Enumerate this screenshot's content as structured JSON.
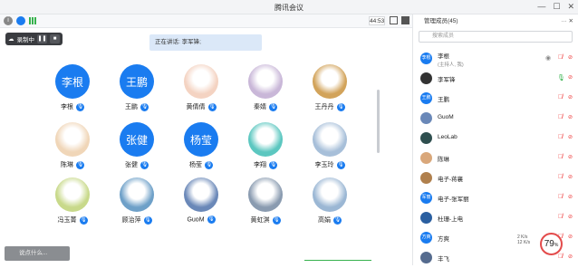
{
  "window": {
    "title": "腾讯会议"
  },
  "toolbar": {
    "timer": "44:53"
  },
  "recording": {
    "label": "录制中"
  },
  "speaking": {
    "text": "正在讲话: 李军锋;"
  },
  "tiles": [
    {
      "name": "李根",
      "avatar_text": "李根",
      "kind": "text"
    },
    {
      "name": "王鹏",
      "avatar_text": "王鹏",
      "kind": "text"
    },
    {
      "name": "黄倩倩",
      "avatar_text": "",
      "kind": "photo",
      "color": "#f4d3c2"
    },
    {
      "name": "秦婧",
      "avatar_text": "",
      "kind": "photo",
      "color": "#c9b7d8"
    },
    {
      "name": "王丹丹",
      "avatar_text": "",
      "kind": "photo",
      "color": "#d2a35a"
    },
    {
      "name": "陈琳",
      "avatar_text": "",
      "kind": "photo",
      "color": "#f0d6b8"
    },
    {
      "name": "张健",
      "avatar_text": "张健",
      "kind": "text"
    },
    {
      "name": "杨莹",
      "avatar_text": "杨莹",
      "kind": "text"
    },
    {
      "name": "李翔",
      "avatar_text": "",
      "kind": "photo",
      "color": "#5cc7c0"
    },
    {
      "name": "李玉玲",
      "avatar_text": "",
      "kind": "photo",
      "color": "#a7bfd9"
    },
    {
      "name": "冯玉菁",
      "avatar_text": "",
      "kind": "photo",
      "color": "#c8d98a"
    },
    {
      "name": "顾治萍",
      "avatar_text": "",
      "kind": "photo",
      "color": "#6ea0c8"
    },
    {
      "name": "GuoM",
      "avatar_text": "",
      "kind": "photo",
      "color": "#6a88b8"
    },
    {
      "name": "黄虹淇",
      "avatar_text": "",
      "kind": "photo",
      "color": "#8a9bb0"
    },
    {
      "name": "高娟",
      "avatar_text": "",
      "kind": "photo",
      "color": "#9bb7d4"
    }
  ],
  "chat_hint": "说点什么...",
  "sidebar": {
    "title": "管理成员(45)",
    "search_placeholder": "搜索成员",
    "members": [
      {
        "name": "李根",
        "sub": "(主持人, 我)",
        "avatar": "李根",
        "color": "#1a7cf0",
        "mic": "off-red",
        "video": "off"
      },
      {
        "name": "李军锋",
        "sub": "",
        "avatar": "",
        "color": "#333333",
        "mic": "on",
        "video": "off"
      },
      {
        "name": "王鹏",
        "sub": "",
        "avatar": "王鹏",
        "color": "#1a7cf0",
        "mic": "off",
        "video": "off"
      },
      {
        "name": "GuoM",
        "sub": "",
        "avatar": "",
        "color": "#6a88b8",
        "mic": "off",
        "video": "off"
      },
      {
        "name": "LeoLab",
        "sub": "",
        "avatar": "",
        "color": "#2f4f4f",
        "mic": "off",
        "video": "off"
      },
      {
        "name": "陈琳",
        "sub": "",
        "avatar": "",
        "color": "#d9a77a",
        "mic": "off",
        "video": "off"
      },
      {
        "name": "电子-蒋襄",
        "sub": "",
        "avatar": "",
        "color": "#b0804d",
        "mic": "off",
        "video": "off"
      },
      {
        "name": "电子-张军丽",
        "sub": "",
        "avatar": "军丽",
        "color": "#1a7cf0",
        "mic": "off",
        "video": "off"
      },
      {
        "name": "杜珊-上电",
        "sub": "",
        "avatar": "",
        "color": "#2a5fa0",
        "mic": "off",
        "video": "off"
      },
      {
        "name": "方爽",
        "sub": "",
        "avatar": "方爽",
        "color": "#1a7cf0",
        "mic": "off",
        "video": "off"
      },
      {
        "name": "丰飞",
        "sub": "",
        "avatar": "",
        "color": "#556b8e",
        "mic": "off",
        "video": "off"
      }
    ]
  },
  "network": {
    "up": "2 K/s",
    "down": "12 K/s",
    "score": "79",
    "unit": "%"
  }
}
